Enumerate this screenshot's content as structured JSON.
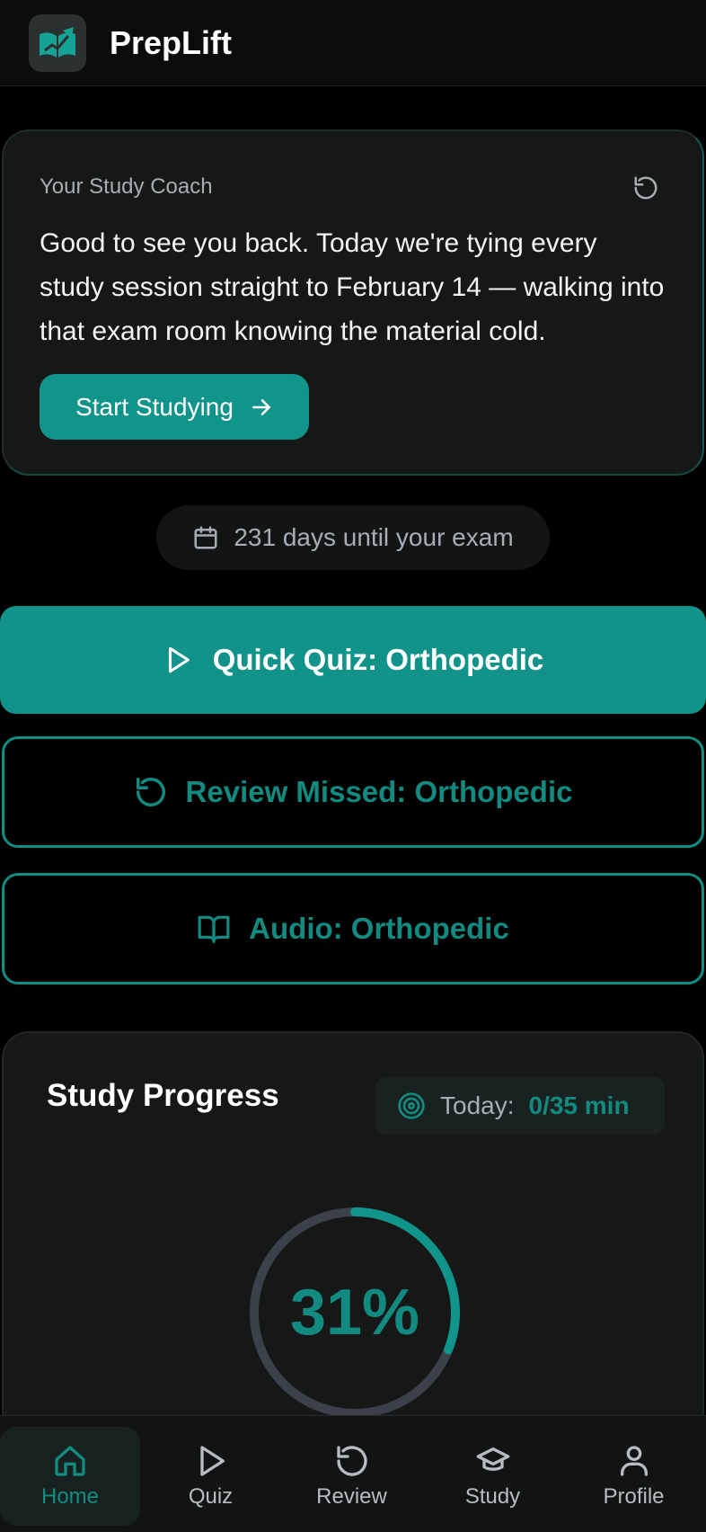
{
  "header": {
    "app_name": "PrepLift",
    "logo_icon": "open-book-growth-icon"
  },
  "coach": {
    "label": "Your Study Coach",
    "message": "Good to see you back. Today we're tying every study session straight to February 14 — walking into that exam room knowing the material cold.",
    "cta_label": "Start Studying",
    "cta_icon": "arrow-right-icon",
    "refresh_icon": "refresh-icon"
  },
  "countdown": {
    "text": "231 days until your exam",
    "icon": "calendar-icon"
  },
  "actions": {
    "quick_quiz": "Quick Quiz: Orthopedic",
    "review_missed": "Review Missed: Orthopedic",
    "audio": "Audio: Orthopedic"
  },
  "progress": {
    "title": "Study Progress",
    "today_label": "Today:",
    "today_value": "0/35 min",
    "percent_label": "31%",
    "percent_value": 0.31
  },
  "nav": {
    "items": [
      {
        "label": "Home",
        "icon": "home-icon",
        "active": true
      },
      {
        "label": "Quiz",
        "icon": "play-icon",
        "active": false
      },
      {
        "label": "Review",
        "icon": "refresh-icon",
        "active": false
      },
      {
        "label": "Study",
        "icon": "graduation-cap-icon",
        "active": false
      },
      {
        "label": "Profile",
        "icon": "user-icon",
        "active": false
      }
    ]
  },
  "colors": {
    "accent": "#11958a",
    "accent_text": "#138a80",
    "background": "#000000",
    "card": "#161717",
    "ring_track": "#3a414b"
  }
}
